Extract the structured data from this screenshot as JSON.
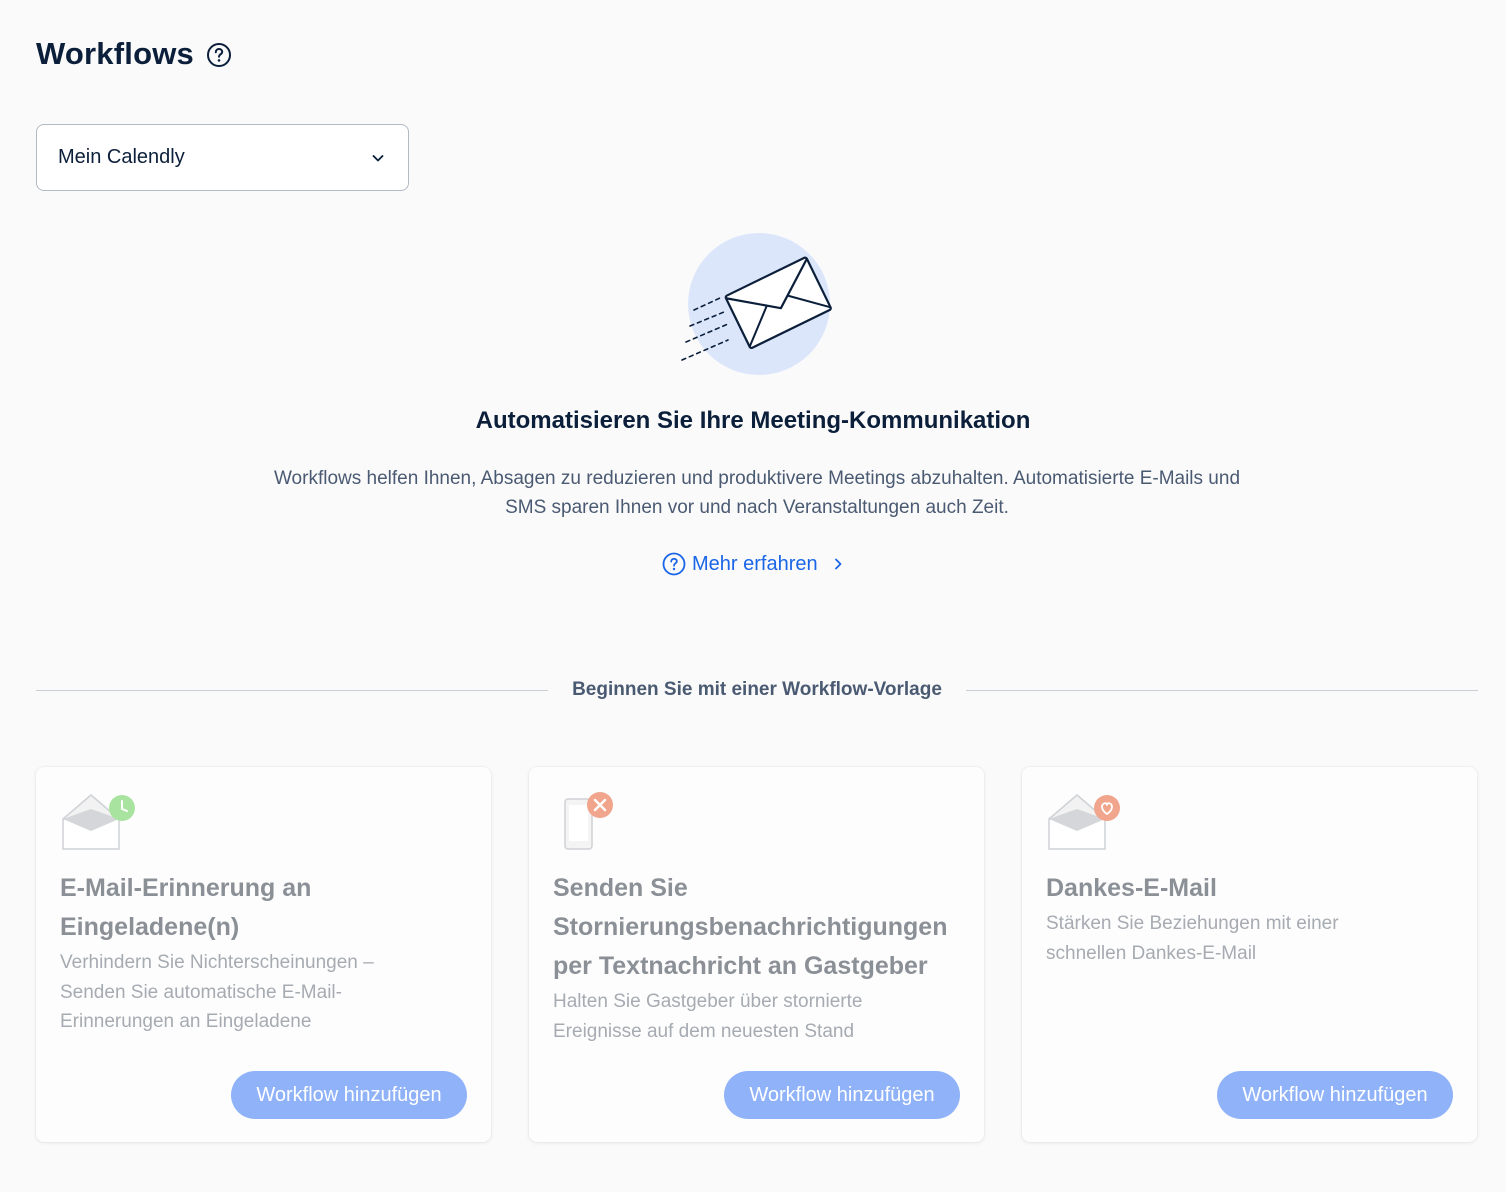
{
  "header": {
    "title": "Workflows",
    "help_icon": "question-circle-icon"
  },
  "account_select": {
    "value": "Mein Calendly",
    "icon": "chevron-down-icon"
  },
  "hero": {
    "illustration": "envelope-sending-icon",
    "title": "Automatisieren Sie Ihre Meeting-Kommunikation",
    "description": "Workflows helfen Ihnen, Absagen zu reduzieren und produktivere Meetings abzuhalten. Automatisierte E-Mails und SMS sparen Ihnen vor und nach Veranstaltungen auch Zeit.",
    "learn_more": "Mehr erfahren"
  },
  "templates": {
    "divider_label": "Beginnen Sie mit einer Workflow-Vorlage",
    "cards": [
      {
        "icon": "envelope-clock-icon",
        "title": "E-Mail-Erinnerung an Eingeladene(n)",
        "description": "Verhindern Sie Nichterscheinungen – Senden Sie automatische E-Mail-Erinnerungen an Eingeladene",
        "button": "Workflow hinzufügen"
      },
      {
        "icon": "phone-cancel-icon",
        "title": "Senden Sie Stornierungsbenachrichtigungen per Textnachricht an Gastgeber",
        "description": "Halten Sie Gastgeber über stornierte Ereignisse auf dem neuesten Stand",
        "button": "Workflow hinzufügen"
      },
      {
        "icon": "envelope-heart-icon",
        "title": "Dankes-E-Mail",
        "description": "Stärken Sie Beziehungen mit einer schnellen Dankes-E-Mail",
        "button": "Workflow hinzufügen"
      }
    ]
  },
  "colors": {
    "background": "#fafafa",
    "primary_text": "#0b1f3a",
    "secondary_text": "#4a5a72",
    "link": "#1a66e6",
    "button_bg": "#8fb2f8",
    "clock_badge": "#a8e4a0",
    "cancel_badge": "#f0a58c",
    "heart_badge": "#f0a58c"
  }
}
